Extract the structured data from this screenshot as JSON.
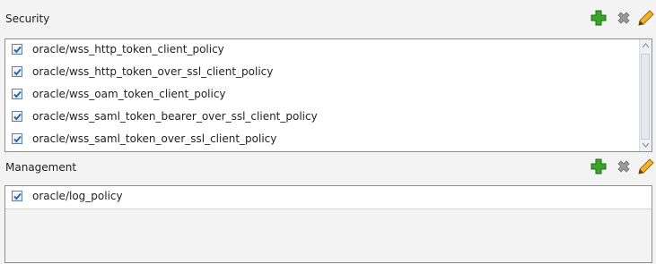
{
  "security": {
    "title": "Security",
    "policies": [
      {
        "label": "oracle/wss_http_token_client_policy",
        "checked": true
      },
      {
        "label": "oracle/wss_http_token_over_ssl_client_policy",
        "checked": true
      },
      {
        "label": "oracle/wss_oam_token_client_policy",
        "checked": true
      },
      {
        "label": "oracle/wss_saml_token_bearer_over_ssl_client_policy",
        "checked": true
      },
      {
        "label": "oracle/wss_saml_token_over_ssl_client_policy",
        "checked": true
      }
    ]
  },
  "management": {
    "title": "Management",
    "policies": [
      {
        "label": "oracle/log_policy",
        "checked": true
      }
    ]
  },
  "icons": {
    "add": "plus-icon",
    "remove": "x-icon",
    "edit": "pencil-icon"
  },
  "colors": {
    "add_green": "#3aa32a",
    "remove_gray": "#8a8a8a",
    "edit_orange": "#e0a020",
    "check_blue": "#2a5d9f"
  }
}
